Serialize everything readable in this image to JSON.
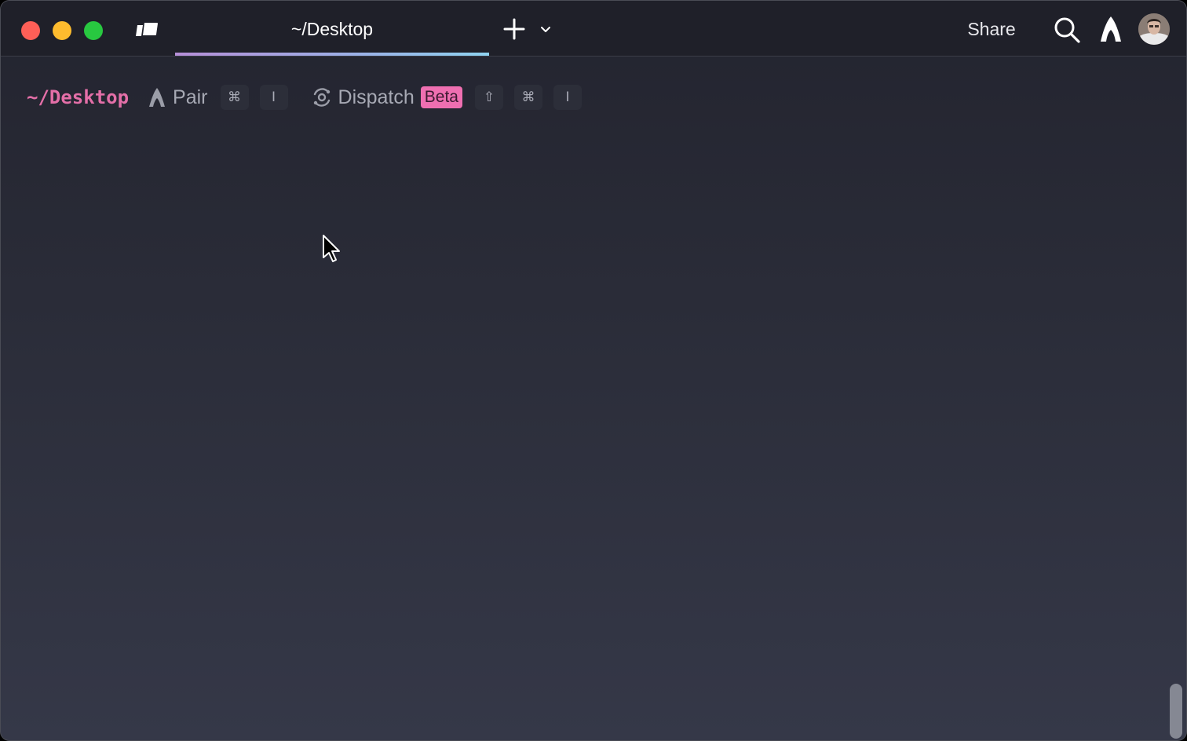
{
  "titlebar": {
    "tab_title": "~/Desktop",
    "share_label": "Share",
    "icons": [
      "tabs-panel-icon",
      "plus-icon",
      "chevron-down-icon",
      "search-icon",
      "warp-logo-icon"
    ]
  },
  "prompt": {
    "cwd": "~/Desktop",
    "pair": {
      "label": "Pair",
      "keys": [
        "⌘",
        "I"
      ]
    },
    "dispatch": {
      "label": "Dispatch",
      "badge": "Beta",
      "keys": [
        "⇧",
        "⌘",
        "I"
      ]
    }
  },
  "colors": {
    "accent_pink": "#e46fa8",
    "beta_badge": "#ef6fb1",
    "close": "#fe5f57",
    "minimize": "#febc2e",
    "maximize": "#28c840"
  }
}
